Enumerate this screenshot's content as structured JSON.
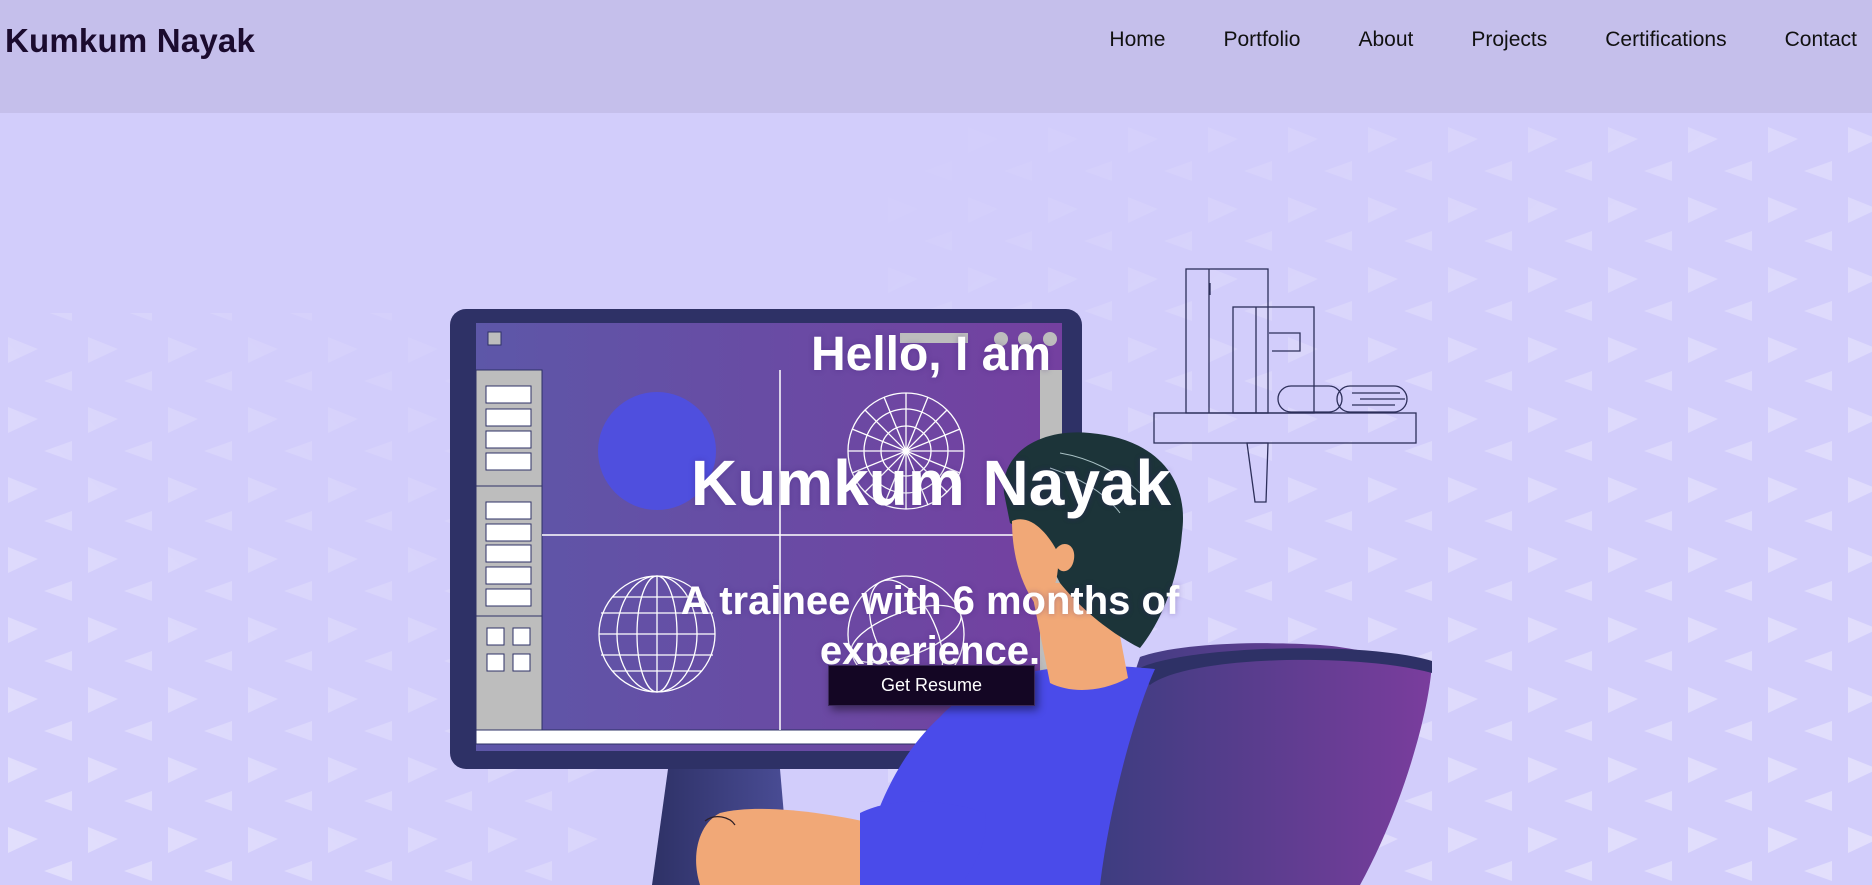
{
  "header": {
    "brand": "Kumkum Nayak",
    "nav": [
      "Home",
      "Portfolio",
      "About",
      "Projects",
      "Certifications",
      "Contact"
    ]
  },
  "hero": {
    "greeting": "Hello, I am",
    "name": "Kumkum Nayak",
    "tagline": "A trainee with 6 months of experience.",
    "cta_label": "Get Resume"
  },
  "colors": {
    "header_bg": "#c5bfeb",
    "hero_bg": "#d2cdfb",
    "button_bg": "#140624",
    "monitor_frame": "#2e3166",
    "screen_gradient_start": "#5d57a8",
    "screen_gradient_end": "#7440a0",
    "shirt": "#4a4bea",
    "skin": "#f1a877",
    "hair": "#1c3439"
  }
}
